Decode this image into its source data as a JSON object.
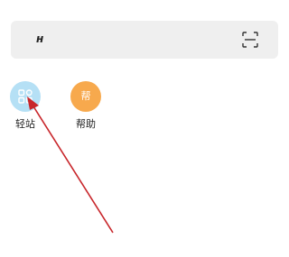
{
  "search": {
    "logo_text": "ʜ",
    "scan_icon": "scan-icon"
  },
  "shortcuts": [
    {
      "label": "轻站",
      "icon": "grid-apps-icon",
      "color": "#b5e0f5"
    },
    {
      "label": "帮助",
      "icon_text": "帮",
      "color": "#f7a94d"
    }
  ],
  "annotation": {
    "arrow_color": "#c8262b"
  }
}
